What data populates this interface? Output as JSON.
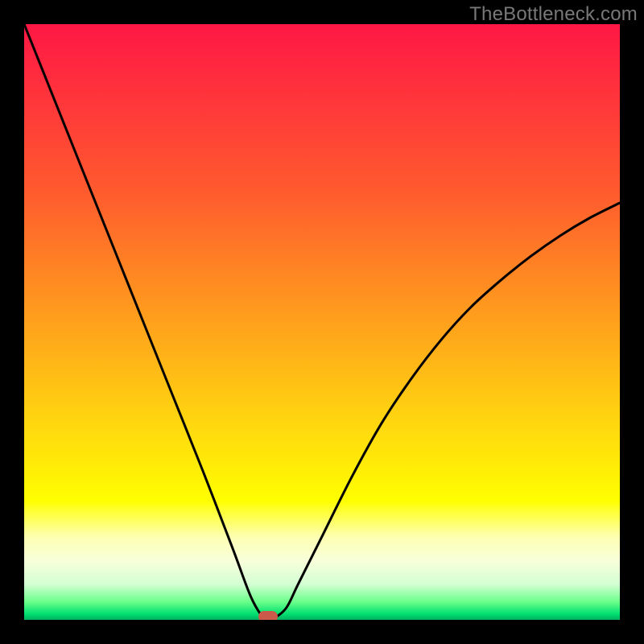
{
  "watermark": "TheBottleneck.com",
  "colors": {
    "frame": "#000000",
    "watermark": "#787878",
    "curve": "#000000",
    "marker": "#cc5a4a",
    "gradient_top": "#ff1744",
    "gradient_mid": "#ffff00",
    "gradient_bottom": "#00b060"
  },
  "chart_data": {
    "type": "line",
    "title": "",
    "xlabel": "",
    "ylabel": "",
    "xlim": [
      0,
      100
    ],
    "ylim": [
      0,
      100
    ],
    "grid": false,
    "legend": false,
    "background": "vertical-gradient-red-to-green",
    "series": [
      {
        "name": "bottleneck-curve",
        "x": [
          0,
          5,
          10,
          15,
          20,
          25,
          30,
          35,
          38,
          40,
          41,
          42,
          44,
          46,
          50,
          55,
          60,
          65,
          70,
          75,
          80,
          85,
          90,
          95,
          100
        ],
        "y": [
          100,
          87.5,
          75,
          62.5,
          50,
          37.5,
          25,
          12,
          4,
          0.5,
          0,
          0.3,
          2,
          6,
          14,
          24,
          33,
          40.5,
          47,
          52.5,
          57,
          61,
          64.5,
          67.5,
          70
        ]
      }
    ],
    "annotations": [
      {
        "name": "optimum-marker",
        "x": 41,
        "y": 0.5,
        "shape": "rounded-rect",
        "color": "#cc5a4a"
      }
    ]
  }
}
